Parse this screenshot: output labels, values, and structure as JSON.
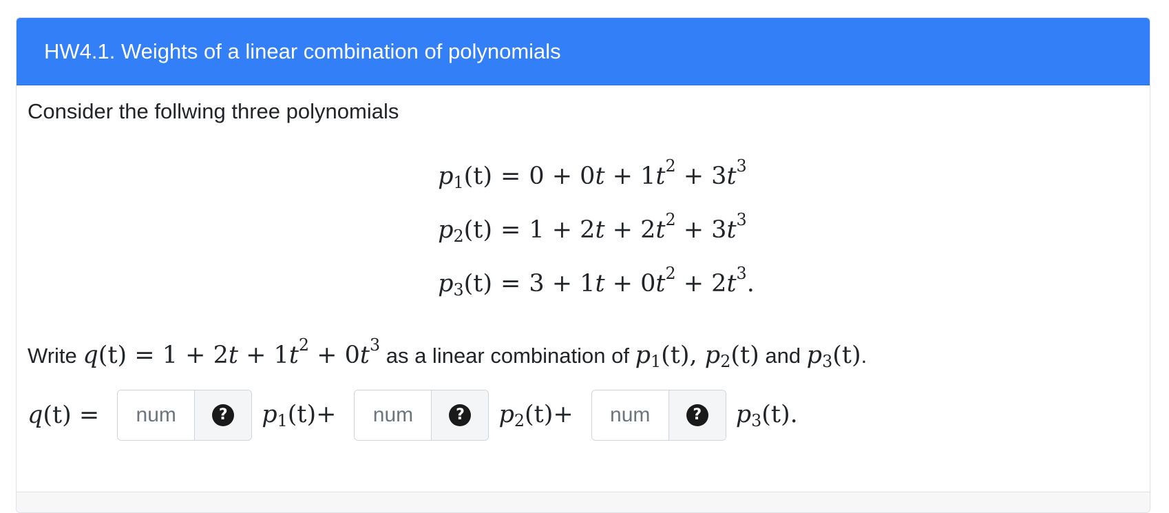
{
  "question": {
    "title": "HW4.1. Weights of a linear combination of polynomials",
    "intro": "Consider the follwing three polynomials",
    "polynomials": [
      {
        "name": "p",
        "sub": "1",
        "lhs_arg": "(t)",
        "rel": "=",
        "rhs": [
          "0 + 0",
          "t",
          " + 1",
          "t",
          "2",
          " + 3",
          "t",
          "3",
          ""
        ]
      },
      {
        "name": "p",
        "sub": "2",
        "lhs_arg": "(t)",
        "rel": "=",
        "rhs": [
          "1 + 2",
          "t",
          " + 2",
          "t",
          "2",
          " + 3",
          "t",
          "3",
          ""
        ]
      },
      {
        "name": "p",
        "sub": "3",
        "lhs_arg": "(t)",
        "rel": "=",
        "rhs": [
          "3 + 1",
          "t",
          " + 0",
          "t",
          "2",
          " + 2",
          "t",
          "3",
          "."
        ]
      }
    ],
    "write": {
      "prefix": "Write ",
      "q_expr_a": "q",
      "q_expr_b": "(t) = 1 + 2",
      "q_t1": "t",
      "q_expr_c": " + 1",
      "q_t2": "t",
      "q_exp2": "2",
      "q_expr_d": " + 0",
      "q_t3": "t",
      "q_exp3": "3",
      "middle": " as a linear combination of ",
      "p1": "p",
      "p1_sub": "1",
      "p1_arg": "(t), ",
      "p2": "p",
      "p2_sub": "2",
      "p2_arg": "(t)",
      "and": " and ",
      "p3": "p",
      "p3_sub": "3",
      "p3_arg": "(t)",
      "end": "."
    },
    "answer": {
      "lhs_q": "q",
      "lhs_rest": "(t) =",
      "placeholder": "num",
      "help_symbol": "?",
      "terms": [
        {
          "p": "p",
          "sub": "1",
          "tail": "(t)+"
        },
        {
          "p": "p",
          "sub": "2",
          "tail": "(t)+"
        },
        {
          "p": "p",
          "sub": "3",
          "tail": "(t)."
        }
      ]
    }
  }
}
